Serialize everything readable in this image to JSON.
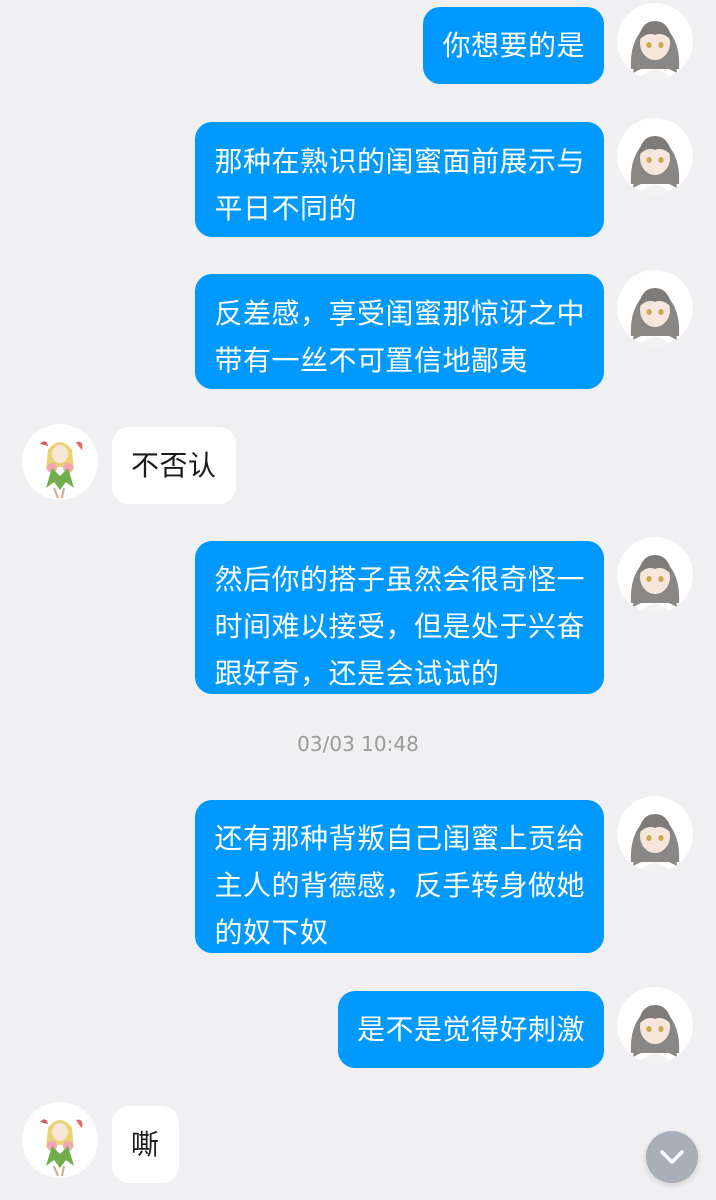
{
  "messages": [
    {
      "side": "out",
      "lines": [
        "你想要的是"
      ]
    },
    {
      "side": "out",
      "lines": [
        "那种在熟识的闺蜜面前展示与",
        "平日不同的"
      ]
    },
    {
      "side": "out",
      "lines": [
        "反差感，享受闺蜜那惊讶之中",
        "带有一丝不可置信地鄙夷"
      ]
    },
    {
      "side": "in",
      "lines": [
        "不否认"
      ]
    },
    {
      "side": "out",
      "lines": [
        "然后你的搭子虽然会很奇怪一",
        "时间难以接受，但是处于兴奋",
        "跟好奇，还是会试试的"
      ]
    },
    {
      "side": "out",
      "lines": [
        "还有那种背叛自己闺蜜上贡给",
        "主人的背德感，反手转身做她",
        "的奴下奴"
      ]
    },
    {
      "side": "out",
      "lines": [
        "是不是觉得好刺激"
      ]
    },
    {
      "side": "in",
      "lines": [
        "嘶"
      ]
    }
  ],
  "timestamp": "03/03 10:48",
  "colors": {
    "background": "#f0f0f2",
    "outgoing_bubble": "#0099ff",
    "incoming_bubble": "#ffffff",
    "timestamp_text": "#9a9a9a",
    "scroll_button": "#a9aeb8"
  },
  "icons": {
    "self_avatar": "gray-haired-anime-girl-avatar",
    "other_avatar": "flower-fairy-anime-avatar",
    "scroll_button": "chevron-down-icon"
  }
}
